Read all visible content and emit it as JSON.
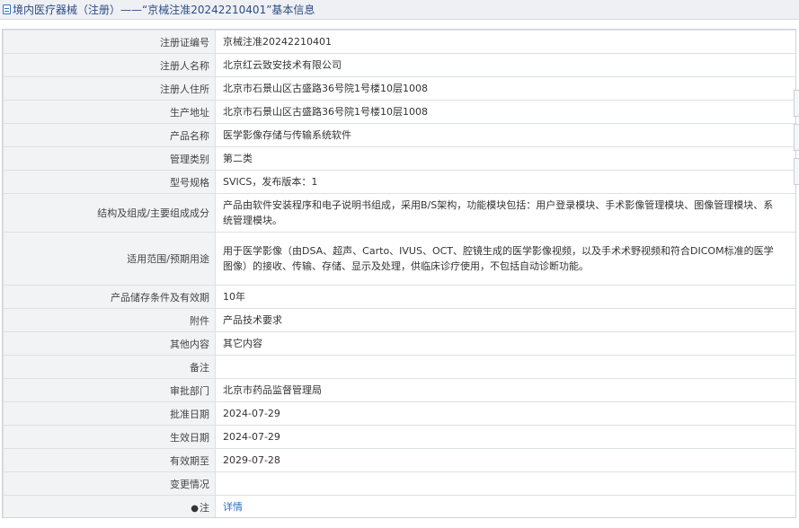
{
  "header": {
    "title": "境内医疗器械（注册）——“京械注准20242210401”基本信息"
  },
  "rows": [
    {
      "label": "注册证编号",
      "value": "京械注准20242210401"
    },
    {
      "label": "注册人名称",
      "value": "北京红云致安技术有限公司"
    },
    {
      "label": "注册人住所",
      "value": "北京市石景山区古盛路36号院1号楼10层1008"
    },
    {
      "label": "生产地址",
      "value": "北京市石景山区古盛路36号院1号楼10层1008"
    },
    {
      "label": "产品名称",
      "value": "医学影像存储与传输系统软件"
    },
    {
      "label": "管理类别",
      "value": "第二类"
    },
    {
      "label": "型号规格",
      "value": "SVICS，发布版本：1"
    },
    {
      "label": "结构及组成/主要组成成分",
      "value": "产品由软件安装程序和电子说明书组成，采用B/S架构，功能模块包括：用户登录模块、手术影像管理模块、图像管理模块、系统管理模块。"
    },
    {
      "label": "适用范围/预期用途",
      "value": "用于医学影像（由DSA、超声、Carto、IVUS、OCT、腔镜生成的医学影像视频，以及手术术野视频和符合DICOM标准的医学图像）的接收、传输、存储、显示及处理，供临床诊疗使用，不包括自动诊断功能。"
    },
    {
      "label": "产品储存条件及有效期",
      "value": "10年"
    },
    {
      "label": "附件",
      "value": "产品技术要求"
    },
    {
      "label": "其他内容",
      "value": "其它内容"
    },
    {
      "label": "备注",
      "value": ""
    },
    {
      "label": "审批部门",
      "value": "北京市药品监督管理局"
    },
    {
      "label": "批准日期",
      "value": "2024-07-29"
    },
    {
      "label": "生效日期",
      "value": "2024-07-29"
    },
    {
      "label": "有效期至",
      "value": "2029-07-28"
    },
    {
      "label": "变更情况",
      "value": ""
    }
  ],
  "note": {
    "label": "注",
    "link": "详情"
  }
}
